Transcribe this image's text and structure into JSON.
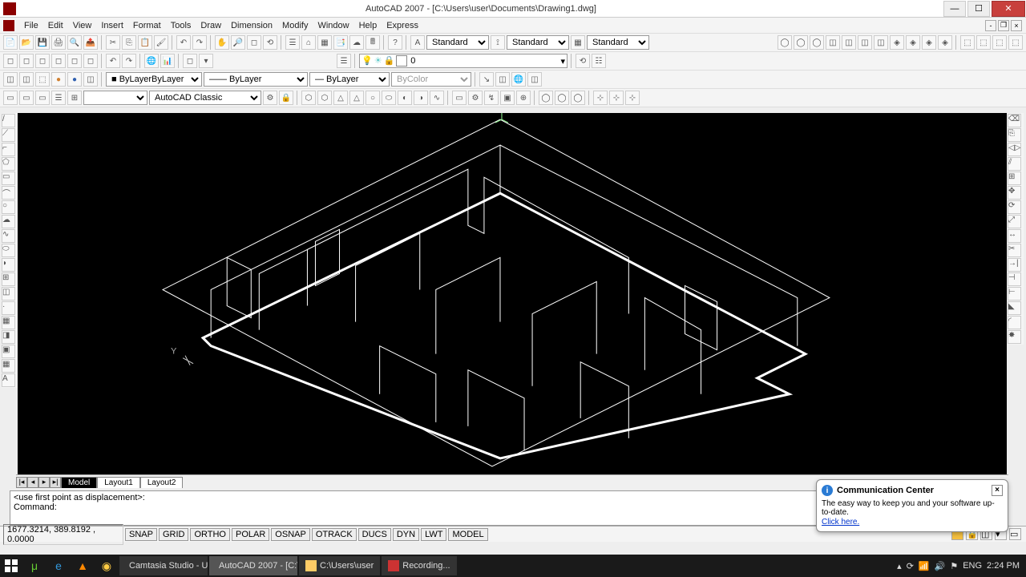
{
  "title": "AutoCAD 2007 - [C:\\Users\\user\\Documents\\Drawing1.dwg]",
  "menus": [
    "File",
    "Edit",
    "View",
    "Insert",
    "Format",
    "Tools",
    "Draw",
    "Dimension",
    "Modify",
    "Window",
    "Help",
    "Express"
  ],
  "styles": {
    "text_style": "Standard",
    "dim_style": "Standard",
    "table_style": "Standard"
  },
  "layer": {
    "current": "0",
    "line_layer": "ByLayer",
    "linetype": "ByLayer",
    "lineweight": "ByLayer",
    "color": "ByColor"
  },
  "workspace_name": "AutoCAD Classic",
  "tabs": {
    "active": "Model",
    "others": [
      "Layout1",
      "Layout2"
    ]
  },
  "command": {
    "history": "<use first point as displacement>:",
    "prompt": "Command:"
  },
  "status": {
    "coords": "1677.3214, 389.8192 , 0.0000",
    "toggles": [
      "SNAP",
      "GRID",
      "ORTHO",
      "POLAR",
      "OSNAP",
      "OTRACK",
      "DUCS",
      "DYN",
      "LWT",
      "MODEL"
    ]
  },
  "popup": {
    "title": "Communication Center",
    "body": "The easy way to keep you and your software up-to-date.",
    "link": "Click here."
  },
  "taskbar": {
    "tasks": [
      "Camtasia Studio - U...",
      "AutoCAD 2007 - [C:\\...",
      "C:\\Users\\user",
      "Recording..."
    ],
    "lang": "ENG",
    "time": "2:24 PM"
  },
  "axis_label": "Y"
}
